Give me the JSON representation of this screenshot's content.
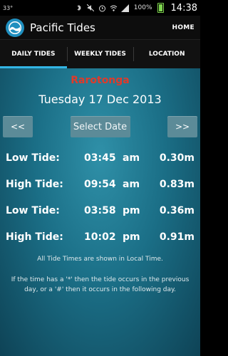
{
  "status": {
    "left_text": "33°",
    "battery_pct": "100%",
    "time": "14:38"
  },
  "app": {
    "title": "Pacific Tides",
    "home_label": "HOME"
  },
  "tabs": [
    {
      "label": "DAILY TIDES"
    },
    {
      "label": "WEEKLY TIDES"
    },
    {
      "label": "LOCATION"
    }
  ],
  "main": {
    "location": "Rarotonga",
    "date": "Tuesday 17 Dec 2013",
    "prev_label": "<<",
    "select_label": "Select Date",
    "next_label": ">>",
    "tides": [
      {
        "type": "Low Tide:",
        "time": "03:45",
        "ampm": "am",
        "height": "0.30m"
      },
      {
        "type": "High Tide:",
        "time": "09:54",
        "ampm": "am",
        "height": "0.83m"
      },
      {
        "type": "Low Tide:",
        "time": "03:58",
        "ampm": "pm",
        "height": "0.36m"
      },
      {
        "type": "High Tide:",
        "time": "10:02",
        "ampm": "pm",
        "height": "0.91m"
      }
    ],
    "note_local": "All Tide Times are shown in Local Time.",
    "note_symbols": "If the time has a '*' then the tide occurs in the previous day, or a '#' then it occurs in the following day."
  },
  "colors": {
    "accent": "#33b5e5",
    "location": "#e03a2a"
  }
}
